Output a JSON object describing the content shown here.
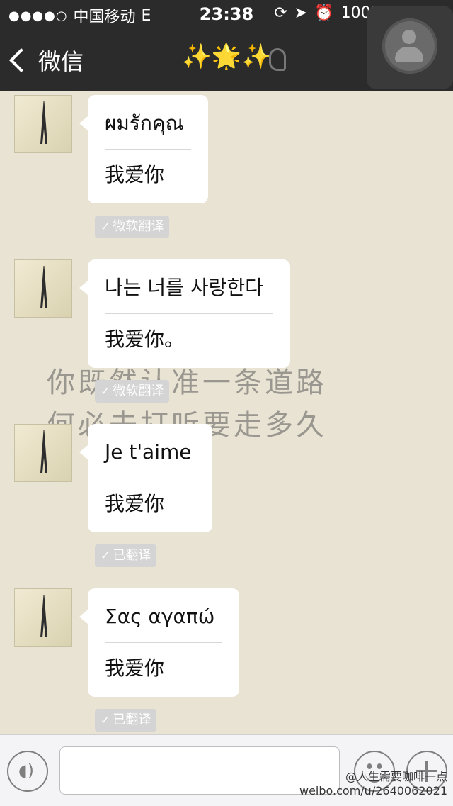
{
  "status": {
    "signal": "●●●●○",
    "carrier": "中国移动",
    "network": "E",
    "time": "23:38",
    "battery": "100%"
  },
  "nav": {
    "back_label": "微信",
    "title": "✨🌟✨"
  },
  "watermark": {
    "line1": "你既然认准一条道路",
    "line2": "何必去打听要走多久"
  },
  "messages": [
    {
      "original": "ผมรักคุณ",
      "translation": "我爱你",
      "tag": "微软翻译"
    },
    {
      "original": "나는 너를 사랑한다",
      "translation": "我爱你。",
      "tag": "微软翻译"
    },
    {
      "original": "Je t'aime",
      "translation": "我爱你",
      "tag": "已翻译"
    },
    {
      "original": "Σας αγαπώ",
      "translation": "我爱你",
      "tag": "已翻译"
    }
  ],
  "input": {
    "placeholder": ""
  },
  "weibo": {
    "line1": "@人生需要咖啡一点",
    "line2": "weibo.com/u/2640062021"
  },
  "colors": {
    "bar": "#2b2b2b",
    "chat_bg": "#e8e3d2",
    "battery": "#4cd964"
  }
}
